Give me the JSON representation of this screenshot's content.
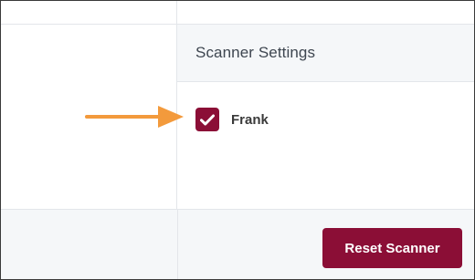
{
  "panel": {
    "title": "Scanner Settings"
  },
  "scanners": [
    {
      "label": "Frank",
      "checked": true,
      "icon": "check-icon"
    }
  ],
  "footer": {
    "reset_label": "Reset Scanner"
  },
  "colors": {
    "accent": "#8b0e36",
    "arrow": "#f39a3c",
    "header_bg": "#f5f7f9",
    "border": "#e3e6ea"
  }
}
